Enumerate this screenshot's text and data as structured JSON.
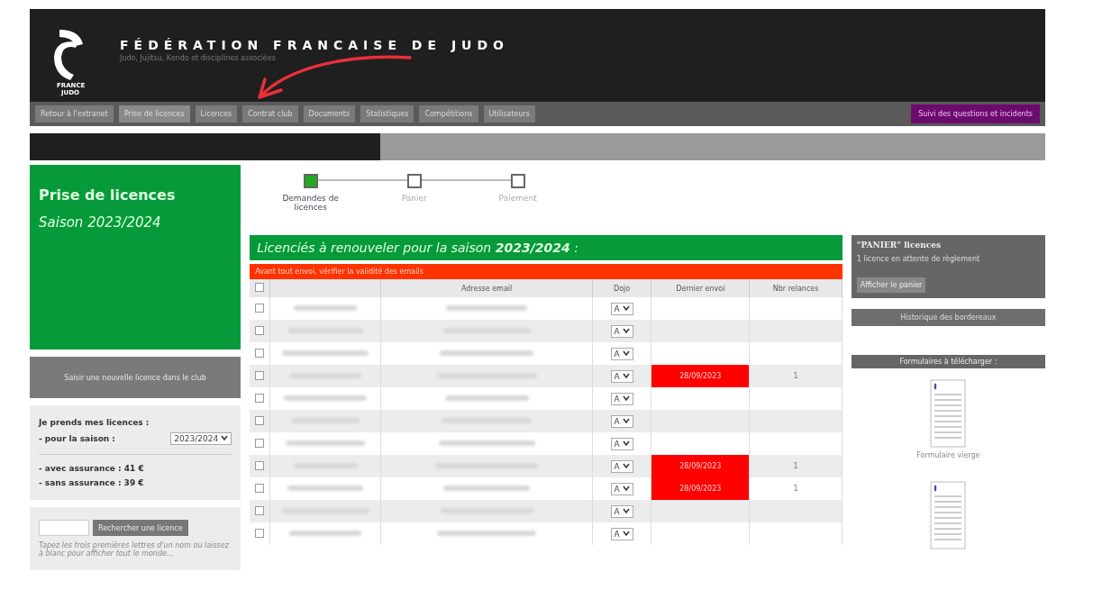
{
  "header": {
    "logo_text": "FRANCE JUDO",
    "title": "FÉDÉRATION FRANCAISE DE JUDO",
    "subtitle": "Judo, Jujitsu, Kendo et disciplines associées"
  },
  "nav": {
    "items": [
      {
        "label": "Retour à l'extranet",
        "selected": false
      },
      {
        "label": "Prise de licences",
        "selected": true
      },
      {
        "label": "Licences",
        "selected": false
      },
      {
        "label": "Contrat club",
        "selected": false
      },
      {
        "label": "Documents",
        "selected": false
      },
      {
        "label": "Statistiques",
        "selected": false
      },
      {
        "label": "Compétitions",
        "selected": false
      },
      {
        "label": "Utilisateurs",
        "selected": false
      }
    ],
    "support": "Suivi des questions et incidents"
  },
  "sidebar": {
    "title": "Prise de licences",
    "season": "Saison 2023/2024",
    "new_licence": "Saisir une nouvelle licence dans le club",
    "pricing": {
      "heading": "Je prends mes licences :",
      "season_label": "- pour la saison :",
      "season_value": "2023/2024",
      "with_insurance": "- avec assurance : 41 €",
      "without_insurance": "- sans assurance : 39 €"
    },
    "search": {
      "button": "Rechercher une licence",
      "hint": "Tapez les trois premières lettres d'un nom ou laissez à blanc pour afficher tout le monde..."
    }
  },
  "steps": [
    {
      "label": "Demandes de licences",
      "selected": true
    },
    {
      "label": "Panier",
      "selected": false
    },
    {
      "label": "Paiement",
      "selected": false
    }
  ],
  "table": {
    "title": "Licenciés à renouveler pour la saison **2023/2024** :",
    "warning": "Avant tout envoi, vérifier la validité des emails",
    "select_all_checked": false,
    "columns": [
      "Adresse email",
      "Dojo",
      "Dernier envoi",
      "Nbr relances"
    ],
    "rows": [
      {
        "checked": false,
        "dojo": "A"
      },
      {
        "checked": false,
        "dojo": "A"
      },
      {
        "checked": false,
        "dojo": "A"
      },
      {
        "checked": false,
        "dojo": "A",
        "last_sent": "28/09/2023",
        "reminders": "1"
      },
      {
        "checked": false,
        "dojo": "A"
      },
      {
        "checked": false,
        "dojo": "A"
      },
      {
        "checked": false,
        "dojo": "A"
      },
      {
        "checked": false,
        "dojo": "A",
        "last_sent": "28/09/2023",
        "reminders": "1"
      },
      {
        "checked": false,
        "dojo": "A",
        "last_sent": "28/09/2023",
        "reminders": "1"
      },
      {
        "checked": false,
        "dojo": "A"
      },
      {
        "checked": false,
        "dojo": "A"
      }
    ]
  },
  "cart": {
    "title": "\"PANIER\" licences",
    "status": "1 licence en attente de règlement",
    "button": "Afficher le panier"
  },
  "history": "Historique des bordereaux",
  "forms": {
    "title": "Formulaires à télécharger :",
    "items": [
      {
        "kind": "document",
        "caption": "Formulaire vierge"
      },
      {
        "kind": "document"
      }
    ]
  }
}
